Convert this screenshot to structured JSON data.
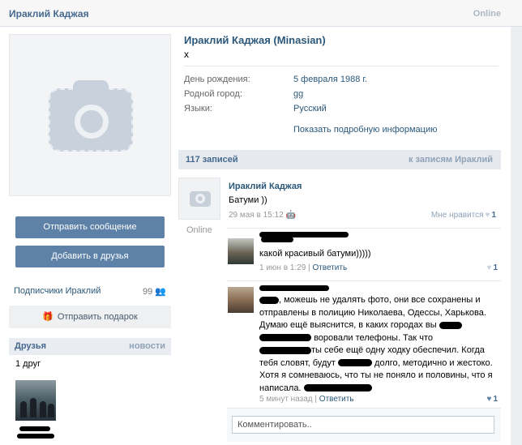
{
  "window": {
    "title": "Ираклий Каджая",
    "online": "Online"
  },
  "profile": {
    "full_name": "Ираклий Каджая (Minasian)",
    "status": "x",
    "info": [
      {
        "label": "День рождения:",
        "value": "5 февраля 1988 г."
      },
      {
        "label": "Родной город:",
        "value": "gg"
      },
      {
        "label": "Языки:",
        "value": "Русский"
      }
    ],
    "show_more": "Показать подробную информацию"
  },
  "sidebar": {
    "send_message": "Отправить сообщение",
    "add_friend": "Добавить в друзья",
    "subscribers_label": "Подписчики Ираклий",
    "subscribers_count": "99",
    "gift": "Отправить подарок",
    "friends_title": "Друзья",
    "friends_news": "новости",
    "friends_count": "1 друг"
  },
  "wall": {
    "count": "117 записей",
    "to_wall": "к записям Ираклий",
    "post": {
      "avatar_status": "Online",
      "author": "Ираклий Каджая",
      "text": "Батуми ))",
      "date": "29 мая в 15:12",
      "like_label": "Мне нравится",
      "likes": "1"
    },
    "comments": [
      {
        "text": "какой красивый батуми)))))",
        "date": "1 июн в 1:29",
        "reply": "Ответить",
        "likes": "1"
      },
      {
        "text_lines": [
          ", можешь не удалять фото, они все сохранены и",
          "отправлены в полицию Николаева, Одессы, Харькова.",
          "Думаю ещё выяснится, в каких городах вы",
          "воровали телефоны. Так что",
          "ты себе ещё одну ходку обеспечил. Когда",
          "тебя словят, будут",
          "долго, методично и жестоко.",
          "Хотя я сомневаюсь, что ты не поняло и половины, что я",
          "написала."
        ],
        "date": "5 минут назад",
        "reply": "Ответить",
        "likes": "1"
      }
    ],
    "comment_placeholder": "Комментировать.."
  },
  "colors": {
    "link": "#2b587a",
    "button": "#5e81a8",
    "header_bg": "#e6eaef"
  }
}
